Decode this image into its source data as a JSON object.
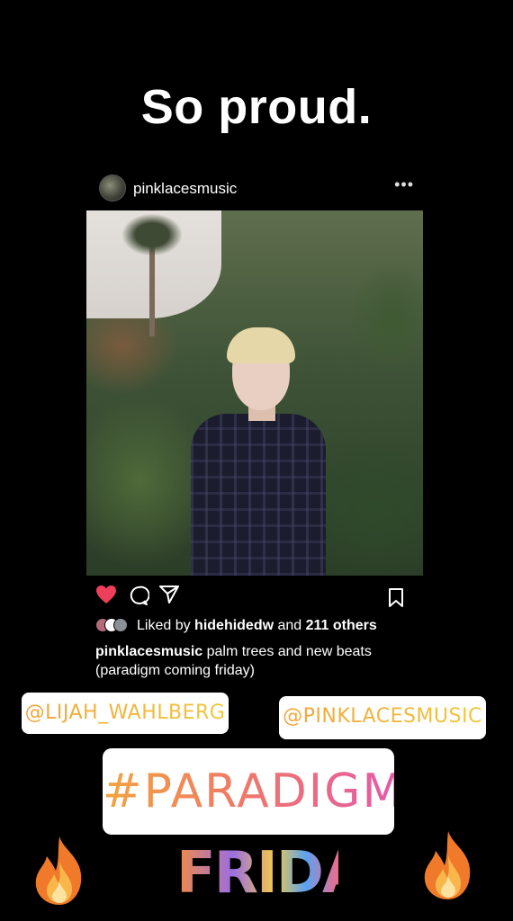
{
  "story": {
    "headline": "So proud."
  },
  "post": {
    "username": "pinklacesmusic",
    "more_icon": "more-dots-icon",
    "liked_by_prefix": "Liked by ",
    "liked_by_user": "hidehidedw",
    "liked_by_and": " and ",
    "liked_by_count": "211 others",
    "caption_user": "pinklacesmusic",
    "caption_text": " palm trees and new beats (paradigm coming friday)"
  },
  "stickers": {
    "mention_1": "@LIJAH_WAHLBERG",
    "mention_2": "@PINKLACESMUSIC",
    "hashtag": "#PARADIGM",
    "friday": "FRIDAY"
  },
  "colors": {
    "background": "#000000",
    "heart": "#ed3f5a",
    "mention_gradient_start": "#f2a33a",
    "mention_gradient_end": "#f0c83a",
    "hashtag_gradient_start": "#f3a43e",
    "hashtag_gradient_end": "#e45aa6"
  }
}
